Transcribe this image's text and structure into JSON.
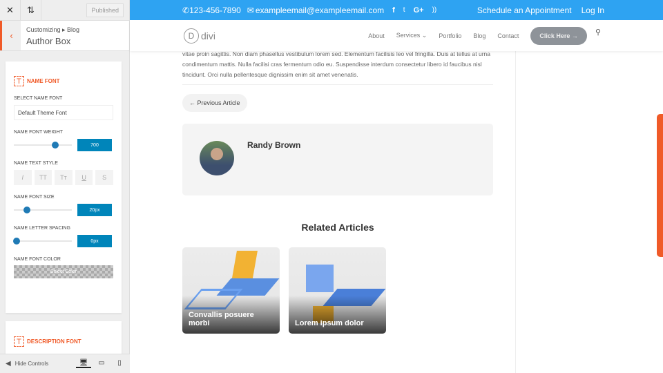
{
  "customizer": {
    "close_icon": "close-icon",
    "published": "Published",
    "breadcrumb": "Customizing ▸ Blog",
    "title": "Author Box",
    "name_section": "NAME FONT",
    "select_font_label": "SELECT NAME FONT",
    "select_font_value": "Default Theme Font",
    "weight_label": "NAME FONT WEIGHT",
    "weight_value": "700",
    "weight_fraction": 0.72,
    "style_label": "NAME TEXT STYLE",
    "styles": [
      "I",
      "TT",
      "Tт",
      "U",
      "S"
    ],
    "size_label": "NAME FONT SIZE",
    "size_value": "20px",
    "size_fraction": 0.23,
    "spacing_label": "NAME LETTER SPACING",
    "spacing_value": "0px",
    "spacing_fraction": 0.05,
    "color_label": "NAME FONT COLOR",
    "color_button": "Select Color",
    "desc_section": "DESCRIPTION FONT",
    "hide_controls": "Hide Controls",
    "accent": "#f05a28"
  },
  "site": {
    "phone": "123-456-7890",
    "email": "exampleemail@exampleemail.com",
    "social": [
      "f",
      "🐦",
      "G+",
      "⌇"
    ],
    "schedule": "Schedule an Appointment",
    "login": "Log In",
    "logo_letter": "D",
    "logo_text": "divi",
    "menu": [
      "About",
      "Services ⌄",
      "Portfolio",
      "Blog",
      "Contact"
    ],
    "cta": "Click Here →",
    "paragraph": "vitae proin sagittis. Non diam phasellus vestibulum lorem sed. Elementum facilisis leo vel fringilla. Duis at tellus at urna condimentum mattis. Nulla facilisi cras fermentum odio eu. Suspendisse interdum consectetur libero id faucibus nisl tincidunt. Orci nulla pellentesque dignissim enim sit amet venenatis.",
    "prev_article": "← Previous Article",
    "author_name": "Randy Brown",
    "related_title": "Related Articles",
    "related": [
      {
        "title": "Convallis posuere morbi"
      },
      {
        "title": "Lorem ipsum dolor"
      }
    ],
    "topbar_color": "#2ea3f2"
  }
}
